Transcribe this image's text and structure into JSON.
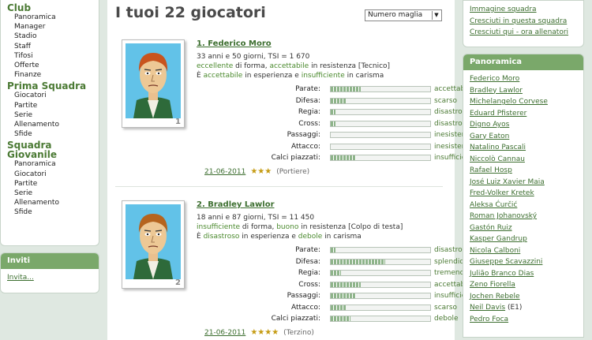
{
  "left_nav": {
    "club": {
      "title": "Club",
      "items": [
        "Panoramica",
        "Manager",
        "Stadio",
        "Staff",
        "Tifosi",
        "Offerte",
        "Finanze"
      ]
    },
    "prima": {
      "title": "Prima Squadra",
      "items": [
        "Giocatori",
        "Partite",
        "Serie",
        "Allenamento",
        "Sfide"
      ]
    },
    "giovanile": {
      "title": "Squadra Giovanile",
      "items": [
        "Panoramica",
        "Giocatori",
        "Partite",
        "Serie",
        "Allenamento",
        "Sfide"
      ]
    }
  },
  "inviti": {
    "title": "Inviti",
    "link": "Invita..."
  },
  "main": {
    "title": "I tuoi 22 giocatori",
    "sort_select": "Numero maglia"
  },
  "players": [
    {
      "name": "1. Federico Moro",
      "shirt": "1",
      "line1": "33 anni e 50 giorni, TSI = 1 670",
      "form": "eccellente",
      "form_text": " di forma, ",
      "stamina": "accettabile",
      "stamina_text": " in resistenza [Tecnico]",
      "exp_pre": "È ",
      "exp": "accettabile",
      "exp_text": " in esperienza e ",
      "lead": "insufficiente",
      "lead_text": " in carisma",
      "skills": [
        {
          "label": "Parate:",
          "value": "accettabile",
          "level": 0.3
        },
        {
          "label": "Difesa:",
          "value": "scarso",
          "level": 0.15
        },
        {
          "label": "Regia:",
          "value": "disastroso",
          "level": 0.05
        },
        {
          "label": "Cross:",
          "value": "disastroso",
          "level": 0.05
        },
        {
          "label": "Passaggi:",
          "value": "inesistente",
          "level": 0.0
        },
        {
          "label": "Attacco:",
          "value": "inesistente",
          "level": 0.0
        },
        {
          "label": "Calci piazzati:",
          "value": "insufficiente",
          "level": 0.25
        }
      ],
      "date": "21-06-2011",
      "stars": "★★★",
      "role": "(Portiere)",
      "hair": "#c8541e"
    },
    {
      "name": "2. Bradley Lawlor",
      "shirt": "2",
      "line1": "18 anni e 87 giorni, TSI = 11 450",
      "form": "insufficiente",
      "form_text": " di forma, ",
      "stamina": "buono",
      "stamina_text": " in resistenza [Colpo di testa]",
      "exp_pre": "È ",
      "exp": "disastroso",
      "exp_text": " in esperienza e ",
      "lead": "debole",
      "lead_text": " in carisma",
      "skills": [
        {
          "label": "Parate:",
          "value": "disastroso",
          "level": 0.05
        },
        {
          "label": "Difesa:",
          "value": "splendido",
          "level": 0.55
        },
        {
          "label": "Regia:",
          "value": "tremendo",
          "level": 0.1
        },
        {
          "label": "Cross:",
          "value": "accettabile",
          "level": 0.3
        },
        {
          "label": "Passaggi:",
          "value": "insufficiente",
          "level": 0.25
        },
        {
          "label": "Attacco:",
          "value": "scarso",
          "level": 0.15
        },
        {
          "label": "Calci piazzati:",
          "value": "debole",
          "level": 0.2
        }
      ],
      "date": "21-06-2011",
      "stars": "★★★★",
      "role": "(Terzino)",
      "hair": "#b5641e"
    }
  ],
  "right_links": [
    "Immagine squadra",
    "Cresciuti in questa squadra",
    "Cresciuti qui - ora allenatori"
  ],
  "panoramica": {
    "title": "Panoramica",
    "players": [
      {
        "name": "Federico Moro"
      },
      {
        "name": "Bradley Lawlor"
      },
      {
        "name": "Michelangelo Corvese"
      },
      {
        "name": "Eduard Pfisterer"
      },
      {
        "name": "Digno Ayos"
      },
      {
        "name": "Gary Eaton"
      },
      {
        "name": "Natalino Pascali"
      },
      {
        "name": "Niccolò Cannau"
      },
      {
        "name": "Rafael Hosp"
      },
      {
        "name": "José Luiz Xavier Maia"
      },
      {
        "name": "Fred-Volker Kretek"
      },
      {
        "name": "Aleksa Ćurčić"
      },
      {
        "name": "Roman Johanovský"
      },
      {
        "name": "Gastón Ruiz"
      },
      {
        "name": "Kasper Gandrup"
      },
      {
        "name": "Nicola Calboni"
      },
      {
        "name": "Giuseppe Scavazzini"
      },
      {
        "name": "Julião Branco Dias"
      },
      {
        "name": "Zeno Fiorella"
      },
      {
        "name": "Jochen Rebele"
      },
      {
        "name": "Neil Davis",
        "extra": "(E1)"
      },
      {
        "name": "Pedro Foca"
      }
    ]
  },
  "colors": {
    "accent": "#4b7a34",
    "header_bar": "#7aa86a",
    "background": "#dfe8e1"
  }
}
